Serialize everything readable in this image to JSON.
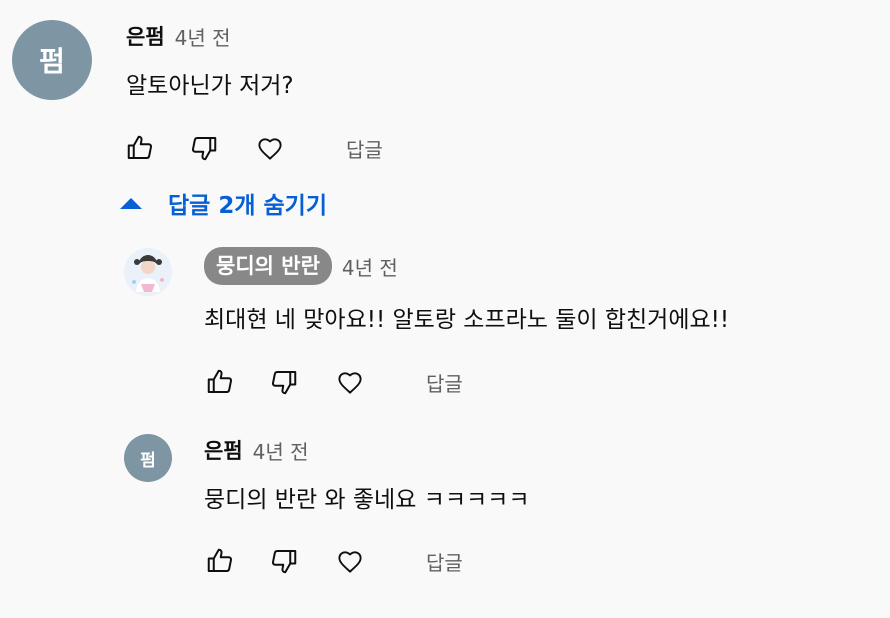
{
  "comments": [
    {
      "avatar_letter": "펌",
      "author": "은펌",
      "time": "4년 전",
      "text": "알토아닌가 저거?",
      "reply_label": "답글"
    }
  ],
  "replies_toggle": {
    "label": "답글 2개 숨기기",
    "icon": "caret-up-icon",
    "color": "#065fd4"
  },
  "replies": [
    {
      "author": "뭉디의 반란",
      "author_is_channel_owner": true,
      "time": "4년 전",
      "text": "최대현 네 맞아요!! 알토랑 소프라노 둘이 합친거에요!!",
      "reply_label": "답글"
    },
    {
      "avatar_letter": "펌",
      "author": "은펌",
      "time": "4년 전",
      "text": "뭉디의 반란 와 좋네요 ㅋㅋㅋㅋㅋ",
      "reply_label": "답글"
    }
  ],
  "icons": {
    "like": "thumbs-up-icon",
    "dislike": "thumbs-down-icon",
    "heart": "heart-icon"
  }
}
